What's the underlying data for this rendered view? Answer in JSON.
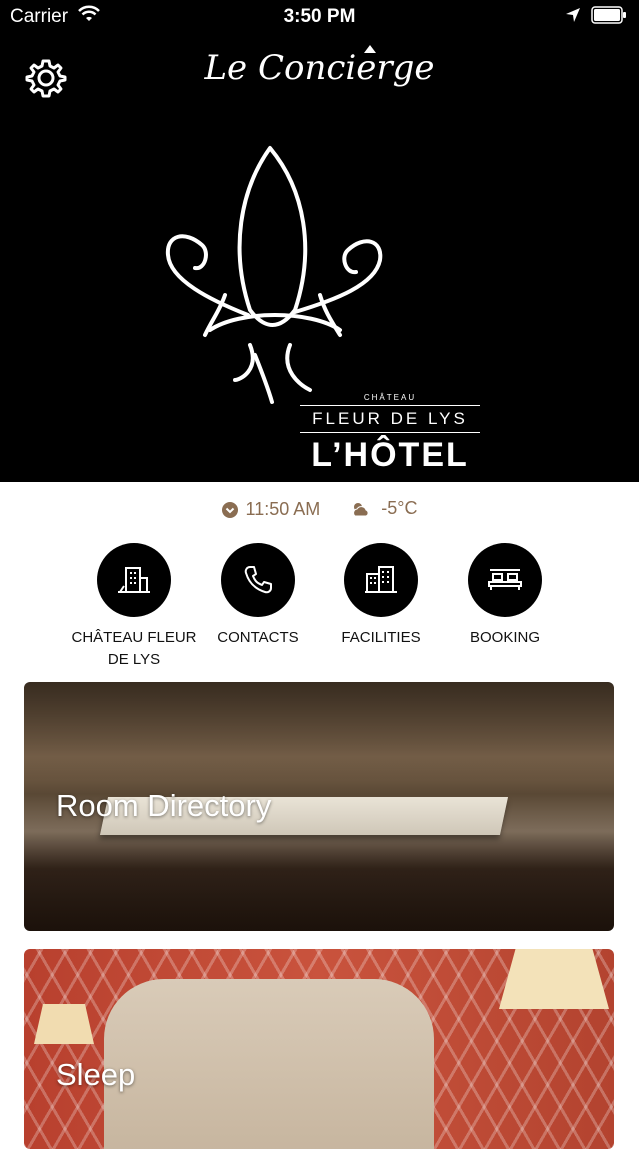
{
  "status_bar": {
    "carrier": "Carrier",
    "time": "3:50 PM"
  },
  "header": {
    "app_title": "Le Concierge"
  },
  "logo": {
    "small_text": "CHÂTEAU",
    "mid_text": "FLEUR DE LYS",
    "big_text": "L’HÔTEL"
  },
  "info": {
    "local_time": "11:50 AM",
    "temperature": "-5°C",
    "accent_color": "#8a6d52"
  },
  "shortcuts": [
    {
      "label": "CHÂTEAU FLEUR DE LYS",
      "icon": "hotel-building-icon"
    },
    {
      "label": "CONTACTS",
      "icon": "phone-icon"
    },
    {
      "label": "FACILITIES",
      "icon": "buildings-icon"
    },
    {
      "label": "BOOKING",
      "icon": "bed-icon"
    }
  ],
  "cards": [
    {
      "label": "Room Directory"
    },
    {
      "label": "Sleep"
    }
  ]
}
